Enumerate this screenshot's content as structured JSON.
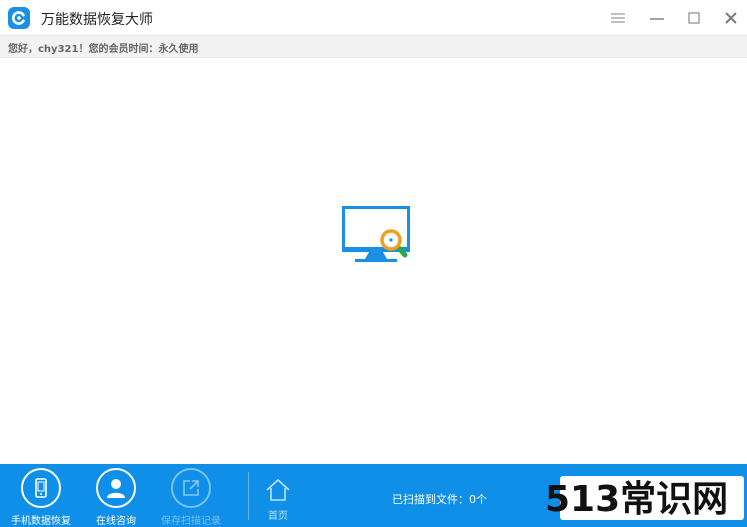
{
  "window": {
    "title": "万能数据恢复大师",
    "controls": [
      "menu-icon",
      "minimize-icon",
      "maximize-icon",
      "close-icon"
    ]
  },
  "member_bar": {
    "text": "您好，chy321！您的会员时间：永久使用"
  },
  "bottom_bar": {
    "tools": [
      {
        "label": "手机数据恢复",
        "icon": "phone-icon",
        "enabled": true
      },
      {
        "label": "在线咨询",
        "icon": "person-icon",
        "enabled": true
      },
      {
        "label": "保存扫描记录",
        "icon": "export-icon",
        "enabled": false
      }
    ],
    "home_label": "首页",
    "scan_count": "已扫描到文件：0个"
  },
  "watermark": {
    "text": "513常识网"
  },
  "colors": {
    "accent": "#0f8fe8",
    "logo": "#1a8fe3",
    "magnifier_ring": "#f0a020",
    "magnifier_handle": "#2aa84a"
  }
}
